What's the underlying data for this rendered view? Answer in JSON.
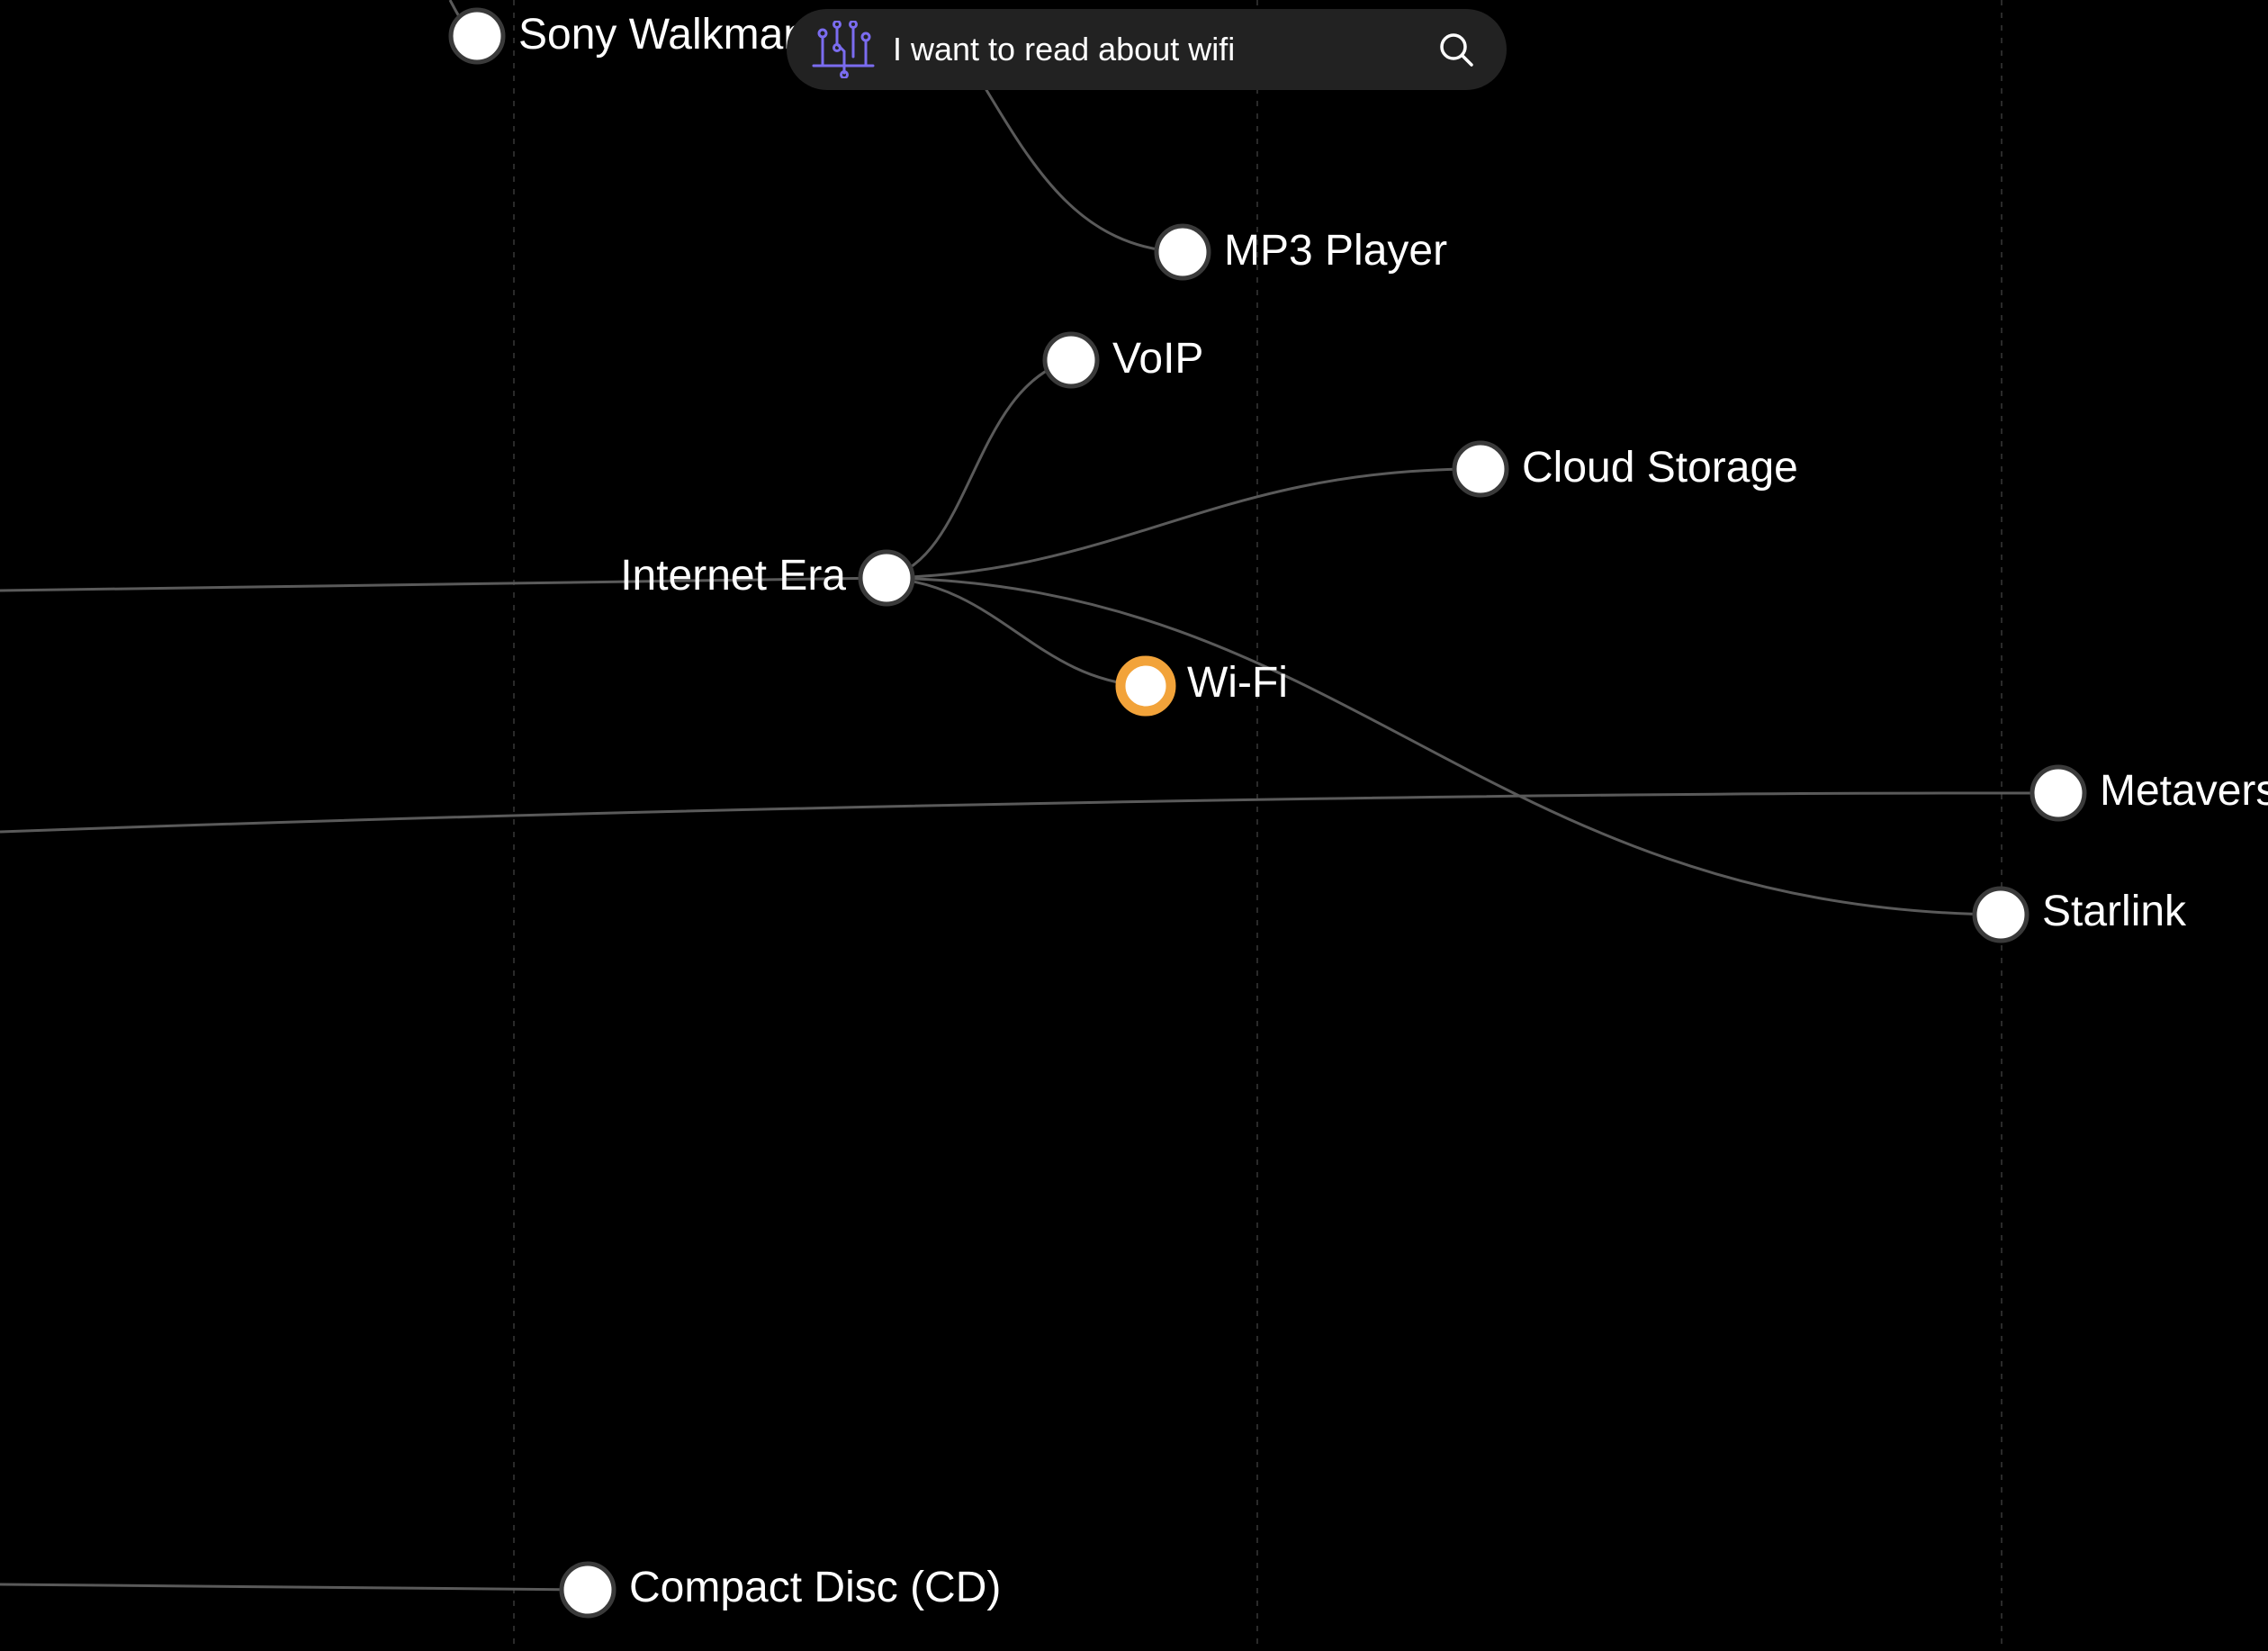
{
  "search": {
    "value": "I want to read about wifi",
    "placeholder": ""
  },
  "colors": {
    "background": "#000000",
    "node_fill": "#ffffff",
    "node_stroke": "#3a3a3a",
    "selected_ring": "#f2a33a",
    "edge": "#5a5a5a",
    "logo_accent": "#7b6cf0"
  },
  "timeline": {
    "nodes": [
      {
        "id": "sony-walkman",
        "label": "Sony Walkman",
        "selected": false
      },
      {
        "id": "mp3-player",
        "label": "MP3 Player",
        "selected": false
      },
      {
        "id": "voip",
        "label": "VoIP",
        "selected": false
      },
      {
        "id": "cloud-storage",
        "label": "Cloud Storage",
        "selected": false
      },
      {
        "id": "internet-era",
        "label": "Internet Era",
        "selected": false
      },
      {
        "id": "wi-fi",
        "label": "Wi-Fi",
        "selected": true
      },
      {
        "id": "metaverse",
        "label": "Metaverse",
        "selected": false
      },
      {
        "id": "starlink",
        "label": "Starlink",
        "selected": false
      },
      {
        "id": "compact-disc",
        "label": "Compact Disc (CD)",
        "selected": false
      }
    ]
  },
  "icons": {
    "logo": "circuit-tree-icon",
    "search": "search-icon"
  }
}
